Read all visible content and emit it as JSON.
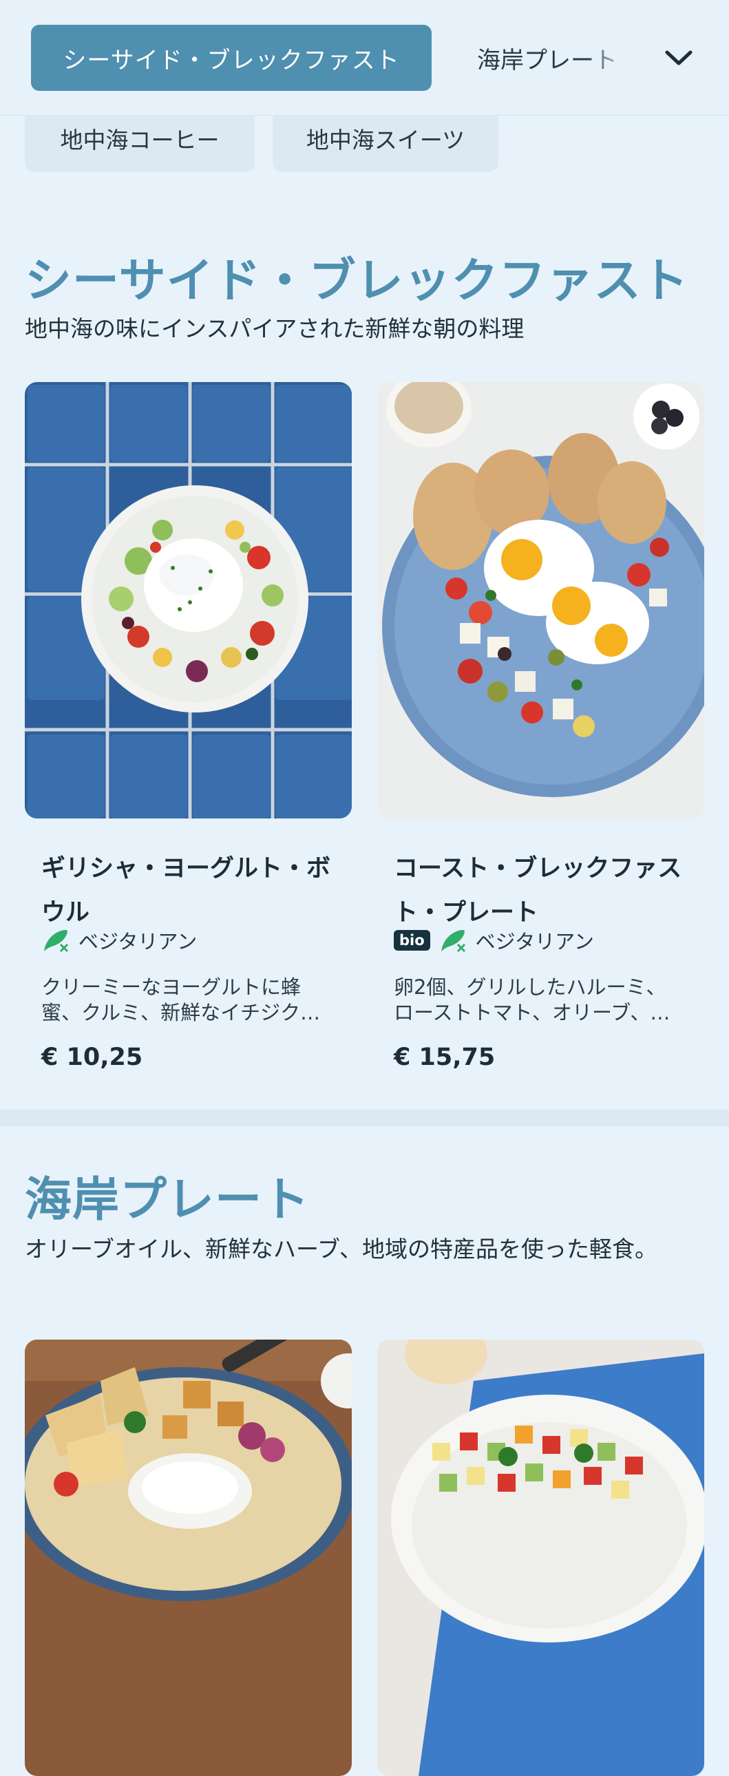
{
  "nav": {
    "active_tab": "シーサイド・ブレックファスト",
    "next_tab": "海岸プレート",
    "chevron_icon": "chevron-down-icon"
  },
  "chips": [
    "地中海コーヒー",
    "地中海スイーツ"
  ],
  "sections": [
    {
      "title": "シーサイド・ブレックファスト",
      "description": "地中海の味にインスパイアされた新鮮な朝の料理",
      "items": [
        {
          "name": "ギリシャ・ヨーグルト・ボウル",
          "tags": [
            "ベジタリアン"
          ],
          "description": "クリーミーなヨーグルトに蜂\n蜜、クルミ、新鮮なイチジク…",
          "price": "€ 10,25"
        },
        {
          "name": "コースト・ブレックファスト・プレート",
          "bio_badge": "bio",
          "tags": [
            "ベジタリアン"
          ],
          "description": "卵2個、グリルしたハルーミ、\nローストトマト、オリーブ、…",
          "price": "€ 15,75"
        }
      ]
    },
    {
      "title": "海岸プレート",
      "description": "オリーブオイル、新鮮なハーブ、地域の特産品を使った軽食。"
    }
  ],
  "colors": {
    "accent": "#4f8fb0",
    "background": "#e8f2fa",
    "vegetarian_icon": "#2fae6c"
  }
}
